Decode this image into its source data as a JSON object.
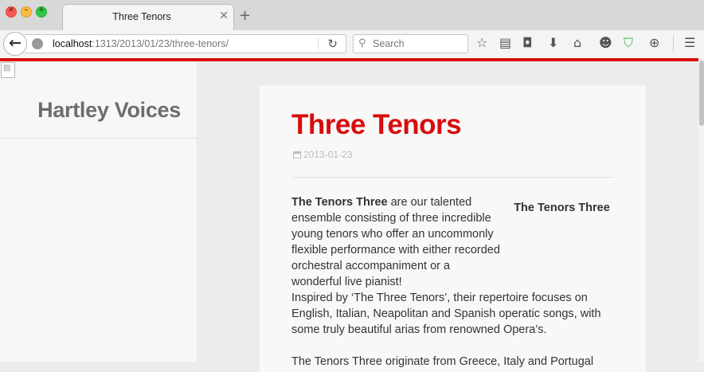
{
  "browser": {
    "tab": {
      "title": "Three Tenors"
    },
    "url": {
      "host": "localhost",
      "path": ":1313/2013/01/23/three-tenors/"
    },
    "search": {
      "placeholder": "Search"
    }
  },
  "site": {
    "title": "Hartley Voices"
  },
  "post": {
    "title": "Three Tenors",
    "date": "2013-01-23",
    "intro_bold": "The Tenors Three",
    "intro_rest": " are our talented ensemble consisting of three incredible young tenors who offer an uncommonly flexible performance with either recorded orchestral accompaniment or a wonderful live pianist!",
    "image_caption": "The Tenors Three",
    "paragraph2": "Inspired by ‘The Three Tenors’, their repertoire focuses on English, Italian, Neapolitan and Spanish operatic songs, with some truly beautiful arias from renowned Opera’s.",
    "paragraph3": "The Tenors Three originate from Greece, Italy and Portugal"
  }
}
